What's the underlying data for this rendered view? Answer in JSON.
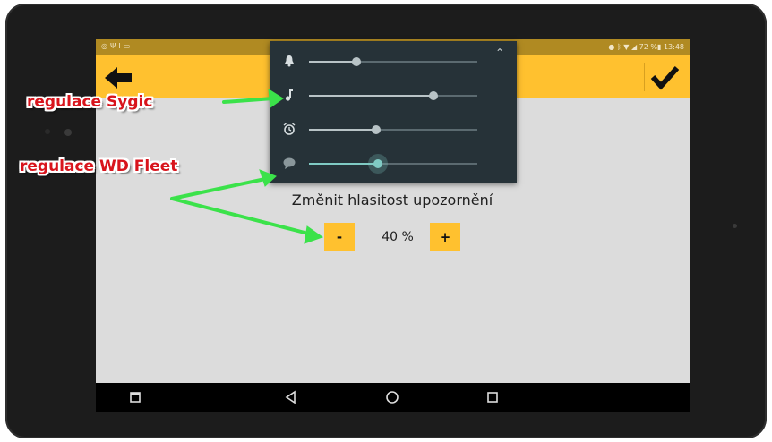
{
  "status_bar": {
    "left_icons": [
      "eye-icon",
      "usb-icon",
      "debug-icon",
      "screenshot-icon"
    ],
    "battery_percent": "72 %",
    "time": "13:48"
  },
  "app_bar": {
    "back_icon": "arrow-left-icon",
    "confirm_icon": "checkmark-icon",
    "accent": "#ffc12f"
  },
  "volume_panel": {
    "background": "#263238",
    "sliders": [
      {
        "icon": "bell-icon",
        "level": 0.28
      },
      {
        "icon": "music-note-icon",
        "level": 0.74
      },
      {
        "icon": "alarm-icon",
        "level": 0.4
      },
      {
        "icon": "speech-bubble-icon",
        "level": 0.41,
        "active": true
      }
    ],
    "collapse_icon": "chevron-up-icon"
  },
  "content": {
    "label": "Změnit hlasitost upozornění",
    "decrease_label": "-",
    "increase_label": "+",
    "volume_value": "40 %"
  },
  "nav_bar": {
    "items": [
      "recents-square-icon",
      "back-triangle-icon",
      "home-circle-icon",
      "overview-square-icon"
    ]
  },
  "annotations": {
    "sygic": "regulace Sygic",
    "wd_fleet": "regulace WD Fleet",
    "color": "#d8141c",
    "arrow_color": "#3be24a"
  }
}
